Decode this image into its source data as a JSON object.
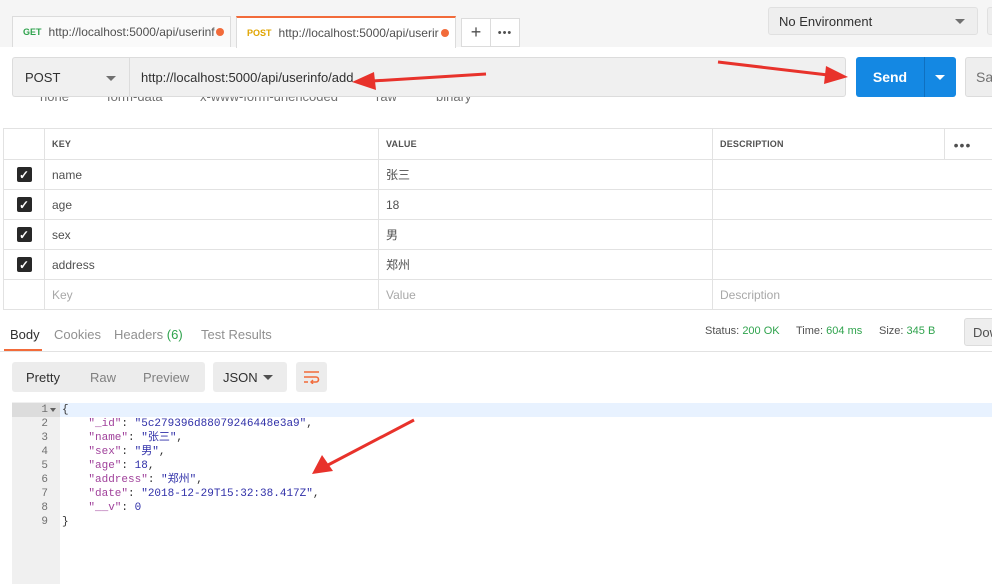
{
  "tabs": [
    {
      "method": "GET",
      "url": "http://localhost:5000/api/userinf",
      "color": "#2fa34d"
    },
    {
      "method": "POST",
      "url": "http://localhost:5000/api/userir",
      "color": "#e0a400"
    }
  ],
  "tab_actions": {
    "add": "+",
    "more": "•••"
  },
  "environment": {
    "selected": "No Environment"
  },
  "request": {
    "method": "POST",
    "url": "http://localhost:5000/api/userinfo/add",
    "send_label": "Send",
    "save_label": "Sav"
  },
  "body_modes_cut": [
    "none",
    "form-data",
    "x-www-form-urlencoded",
    "raw",
    "binary"
  ],
  "params_table": {
    "headers": {
      "key": "KEY",
      "value": "VALUE",
      "description": "DESCRIPTION"
    },
    "more": "•••",
    "rows": [
      {
        "key": "name",
        "value": "张三",
        "checked": true
      },
      {
        "key": "age",
        "value": "18",
        "checked": true
      },
      {
        "key": "sex",
        "value": "男",
        "checked": true
      },
      {
        "key": "address",
        "value": "郑州",
        "checked": true
      }
    ],
    "placeholders": {
      "key": "Key",
      "value": "Value",
      "description": "Description"
    }
  },
  "response_tabs": {
    "body": "Body",
    "cookies": "Cookies",
    "headers": "Headers",
    "headers_count": "(6)",
    "test_results": "Test Results"
  },
  "status_bar": {
    "status_label": "Status:",
    "status_value": "200 OK",
    "time_label": "Time:",
    "time_value": "604 ms",
    "size_label": "Size:",
    "size_value": "345 B",
    "download_label": "Dow"
  },
  "view_modes": {
    "pretty": "Pretty",
    "raw": "Raw",
    "preview": "Preview",
    "format": "JSON"
  },
  "colors": {
    "accent": "#f26b3a",
    "send": "#1488e3",
    "status_ok": "#2fa34d",
    "annotation": "#e8322b"
  },
  "response_lines": [
    {
      "num": "1",
      "text": "{"
    },
    {
      "num": "2",
      "key": "\"_id\"",
      "value": "\"5c279396d88079246448e3a9\"",
      "tail": ","
    },
    {
      "num": "3",
      "key": "\"name\"",
      "value": "\"张三\"",
      "tail": ","
    },
    {
      "num": "4",
      "key": "\"sex\"",
      "value": "\"男\"",
      "tail": ","
    },
    {
      "num": "5",
      "key": "\"age\"",
      "value": "18",
      "tail": ","
    },
    {
      "num": "6",
      "key": "\"address\"",
      "value": "\"郑州\"",
      "tail": ","
    },
    {
      "num": "7",
      "key": "\"date\"",
      "value": "\"2018-12-29T15:32:38.417Z\"",
      "tail": ","
    },
    {
      "num": "8",
      "key": "\"__v\"",
      "value": "0",
      "tail": ""
    },
    {
      "num": "9",
      "text": "}"
    }
  ]
}
